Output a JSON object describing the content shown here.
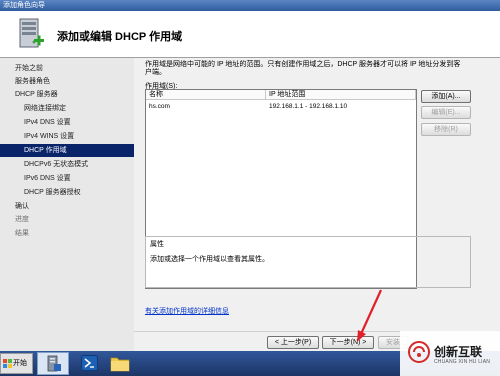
{
  "window": {
    "title": "添加角色向导",
    "header_title": "添加或编辑 DHCP 作用域"
  },
  "nav": {
    "items": [
      {
        "label": "开始之前",
        "level": 0,
        "state": "normal"
      },
      {
        "label": "服务器角色",
        "level": 0,
        "state": "normal"
      },
      {
        "label": "DHCP 服务器",
        "level": 0,
        "state": "normal"
      },
      {
        "label": "网络连接绑定",
        "level": 1,
        "state": "normal"
      },
      {
        "label": "IPv4 DNS 设置",
        "level": 1,
        "state": "normal"
      },
      {
        "label": "IPv4 WINS 设置",
        "level": 1,
        "state": "normal"
      },
      {
        "label": "DHCP 作用域",
        "level": 1,
        "state": "selected"
      },
      {
        "label": "DHCPv6 无状态模式",
        "level": 1,
        "state": "normal"
      },
      {
        "label": "IPv6 DNS 设置",
        "level": 1,
        "state": "normal"
      },
      {
        "label": "DHCP 服务器授权",
        "level": 1,
        "state": "normal"
      },
      {
        "label": "确认",
        "level": 0,
        "state": "normal"
      },
      {
        "label": "进度",
        "level": 0,
        "state": "dim"
      },
      {
        "label": "结果",
        "level": 0,
        "state": "dim"
      }
    ]
  },
  "content": {
    "intro": "作用域是网络中可能的 IP 地址的范围。只有创建作用域之后，DHCP 服务器才可以将 IP 地址分发到客户端。",
    "scopes_label": "作用域(S):",
    "table": {
      "headers": [
        "名称",
        "IP 地址范围"
      ],
      "rows": [
        {
          "name": "hs.com",
          "range": "192.168.1.1 - 192.168.1.10"
        }
      ]
    },
    "buttons": {
      "add": "添加(A)...",
      "edit": "编辑(E)...",
      "delete": "移除(R)"
    },
    "properties": {
      "title": "属性",
      "text": "添加或选择一个作用域以查看其属性。"
    },
    "help_link": "有关添加作用域的详细信息"
  },
  "footer": {
    "prev": "< 上一步(P)",
    "next": "下一步(N) >",
    "install": "安装"
  },
  "taskbar": {
    "start": "开始"
  },
  "watermark": {
    "text": "创新互联",
    "sub": "CHUANG XIN HU LIAN"
  },
  "colors": {
    "selection": "#0a246a",
    "link": "#0033cc",
    "arrow": "#e0202a",
    "title_bar": "#2e5c9e"
  }
}
